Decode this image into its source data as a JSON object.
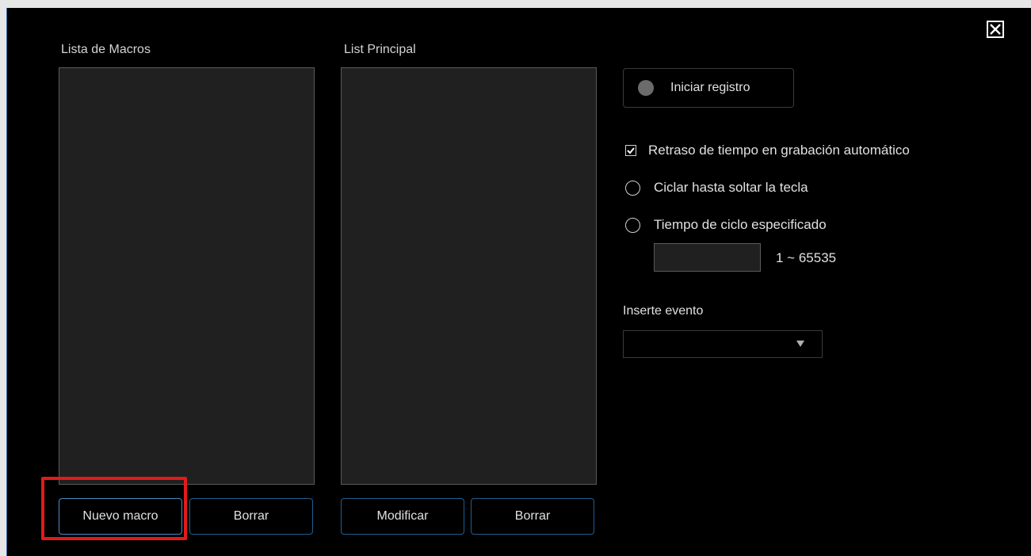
{
  "window": {
    "close_label": "Close"
  },
  "macro_list": {
    "title": "Lista de Macros",
    "items": [],
    "new_button": "Nuevo macro",
    "delete_button": "Borrar"
  },
  "main_list": {
    "title": "List Principal",
    "items": [],
    "modify_button": "Modificar",
    "delete_button": "Borrar"
  },
  "recording": {
    "start_label": "Iniciar registro"
  },
  "options": {
    "auto_delay": {
      "label": "Retraso de tiempo en grabación automático",
      "checked": true
    },
    "loop_until_release": {
      "label": "Ciclar hasta soltar la tecla",
      "selected": false
    },
    "specified_cycles": {
      "label": "Tiempo de ciclo especificado",
      "selected": false,
      "value": "",
      "range_label": "1 ~ 65535"
    }
  },
  "insert_event": {
    "label": "Inserte evento",
    "selected_value": ""
  },
  "colors": {
    "background": "#000000",
    "list_background": "#202020",
    "button_border": "#1f5f93",
    "highlight": "#e31a1a"
  },
  "icons": {
    "close": "close-icon",
    "record": "record-dot-icon",
    "check": "checkmark-icon",
    "dropdown": "triangle-down-icon"
  }
}
